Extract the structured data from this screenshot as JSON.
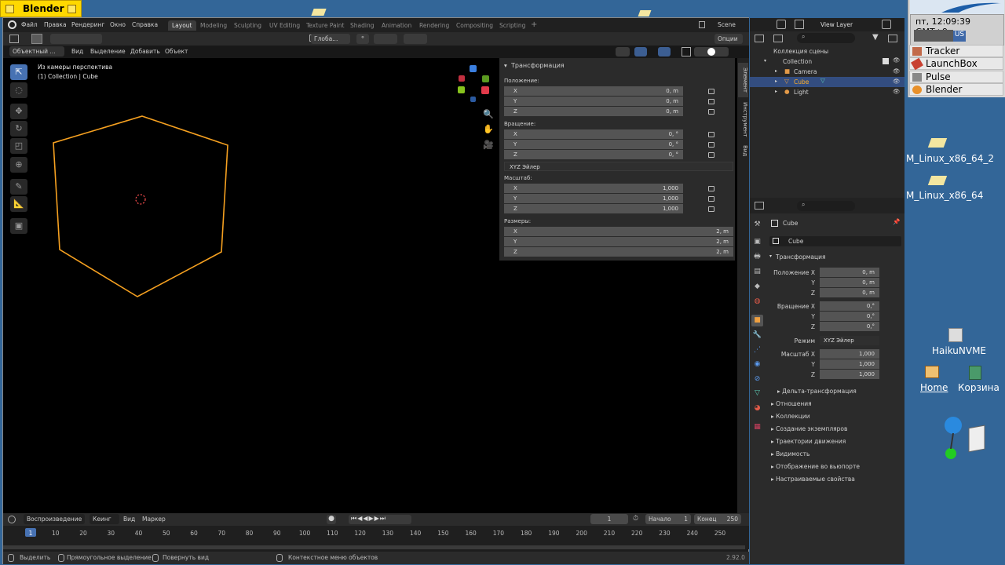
{
  "haiku": {
    "window_title": "Blender",
    "clock": "пт, 12:09:39 GMT+9",
    "keymap": "US",
    "deskbar": [
      {
        "label": "Tracker",
        "icon": "tracker-icon"
      },
      {
        "label": "LaunchBox",
        "icon": "launchbox-icon"
      },
      {
        "label": "Pulse",
        "icon": "pulse-icon"
      },
      {
        "label": "Blender",
        "icon": "blender-icon"
      }
    ],
    "desktop": {
      "icon1": "M_Linux_x86_64_2",
      "icon2": "M_Linux_x86_64",
      "icon3": "HaikuNVME",
      "icon4": "Home",
      "icon5": "Корзина"
    }
  },
  "topbar": {
    "menus": [
      "Файл",
      "Правка",
      "Рендеринг",
      "Окно",
      "Справка"
    ],
    "workspaces": [
      "Layout",
      "Modeling",
      "Sculpting",
      "UV Editing",
      "Texture Paint",
      "Shading",
      "Animation",
      "Rendering",
      "Compositing",
      "Scripting"
    ],
    "active_workspace": "Layout",
    "scene": "Scene",
    "view_layer": "View Layer"
  },
  "toolbar2": {
    "orientation": "Глоба...",
    "options": "Опции"
  },
  "header3": {
    "mode": "Объектный ...",
    "view": "Вид",
    "select": "Выделение",
    "add": "Добавить",
    "object": "Объект"
  },
  "viewport": {
    "line1": "Из камеры перспектива",
    "line2": "(1) Collection | Cube"
  },
  "npanel": {
    "title": "Трансформация",
    "location_label": "Положение:",
    "loc": [
      "0, m",
      "0, m",
      "0, m"
    ],
    "rotation_label": "Вращение:",
    "rot": [
      "0, °",
      "0, °",
      "0, °"
    ],
    "mode": "XYZ Эйлер",
    "scale_label": "Масштаб:",
    "scale": [
      "1,000",
      "1,000",
      "1,000"
    ],
    "dims_label": "Размеры:",
    "dims": [
      "2, m",
      "2, m",
      "2, m"
    ],
    "axes": [
      "X",
      "Y",
      "Z"
    ],
    "tabs": [
      "Элемент",
      "Инструмент",
      "Вид"
    ]
  },
  "timeline": {
    "playback": "Воспроизведение",
    "keying": "Кеинг",
    "view": "Вид",
    "marker": "Маркер",
    "current": "1",
    "start_label": "Начало",
    "start": "1",
    "end_label": "Конец",
    "end": "250",
    "ticks": [
      "1",
      "10",
      "20",
      "30",
      "40",
      "50",
      "60",
      "70",
      "80",
      "90",
      "100",
      "110",
      "120",
      "130",
      "140",
      "150",
      "160",
      "170",
      "180",
      "190",
      "200",
      "210",
      "220",
      "230",
      "240",
      "250"
    ]
  },
  "statusbar": {
    "select": "Выделить",
    "box": "Прямоугольное выделение",
    "rotate": "Повернуть вид",
    "ctx": "Контекстное меню объектов",
    "version": "2.92.0"
  },
  "outliner": {
    "root": "Коллекция сцены",
    "collection": "Collection",
    "items": [
      "Camera",
      "Cube",
      "Light"
    ]
  },
  "properties": {
    "object": "Cube",
    "name": "Cube",
    "section": "Трансформация",
    "loc_label": "Положение X",
    "loc": [
      "0, m",
      "0, m",
      "0, m"
    ],
    "rot_label": "Вращение X",
    "rot": [
      "0,°",
      "0,°",
      "0,°"
    ],
    "mode_label": "Режим",
    "mode": "XYZ Эйлер",
    "scale_label": "Масштаб X",
    "scale": [
      "1,000",
      "1,000",
      "1,000"
    ],
    "y": "Y",
    "z": "Z",
    "delta": "Дельта-трансформация",
    "sections": [
      "Отношения",
      "Коллекции",
      "Создание экземпляров",
      "Траектории движения",
      "Видимость",
      "Отображение во вьюпорте",
      "Настраиваемые свойства"
    ]
  },
  "colors": {
    "accent": "#4772b3",
    "selection": "#ff9a1a",
    "haiku_bg": "#336698",
    "tab": "#ffd800"
  }
}
